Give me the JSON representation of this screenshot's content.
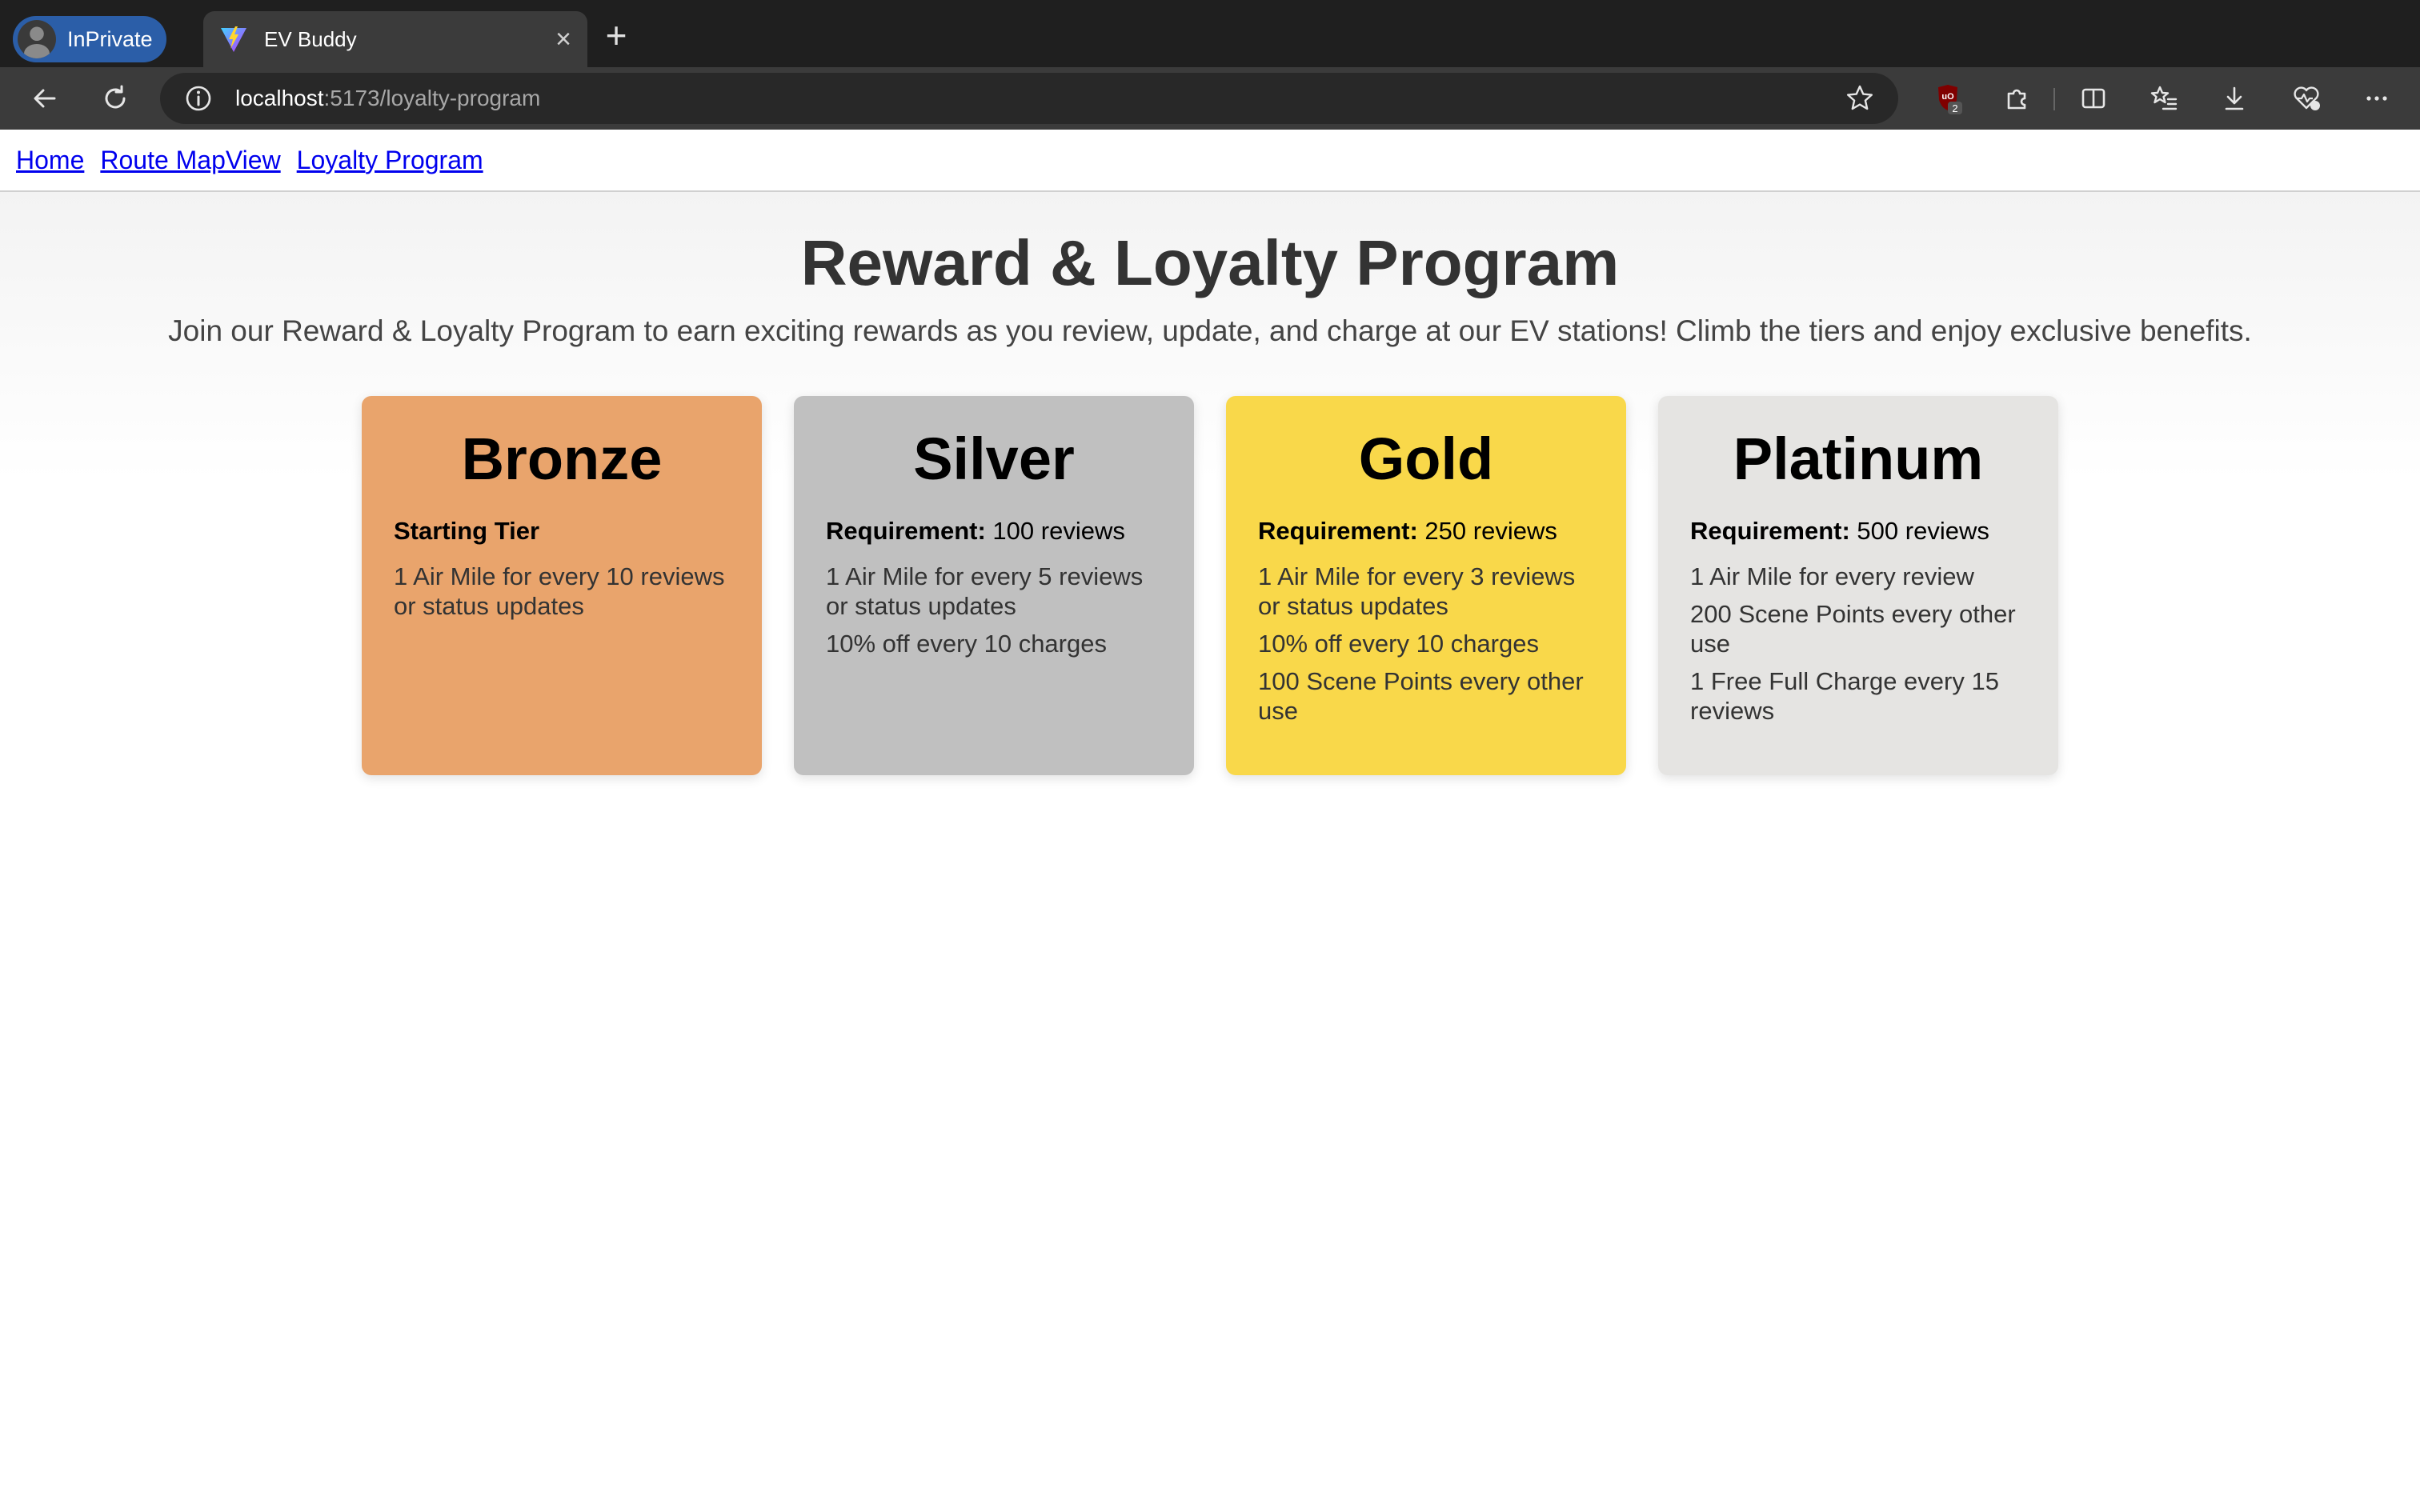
{
  "browser": {
    "inprivate_label": "InPrivate",
    "tab_title": "EV Buddy",
    "close_glyph": "×",
    "newtab_glyph": "+",
    "url_host": "localhost",
    "url_path": ":5173/loyalty-program",
    "extension_badge": "2"
  },
  "nav": {
    "links": [
      "Home",
      "Route MapView",
      "Loyalty Program"
    ]
  },
  "header": {
    "title": "Reward & Loyalty Program",
    "intro": "Join our Reward & Loyalty Program to earn exciting rewards as you review, update, and charge at our EV stations! Climb the tiers and enjoy exclusive benefits."
  },
  "tiers": [
    {
      "name": "Bronze",
      "requirement_label": "Starting Tier",
      "requirement_value": "",
      "benefits": [
        "1 Air Mile for every 10 reviews or status updates"
      ],
      "color": "#e9a46c"
    },
    {
      "name": "Silver",
      "requirement_label": "Requirement:",
      "requirement_value": " 100 reviews",
      "benefits": [
        "1 Air Mile for every 5 reviews or status updates",
        "10% off every 10 charges"
      ],
      "color": "#c0c0c0"
    },
    {
      "name": "Gold",
      "requirement_label": "Requirement:",
      "requirement_value": " 250 reviews",
      "benefits": [
        "1 Air Mile for every 3 reviews or status updates",
        "10% off every 10 charges",
        "100 Scene Points every other use"
      ],
      "color": "#f9d84a"
    },
    {
      "name": "Platinum",
      "requirement_label": "Requirement:",
      "requirement_value": " 500 reviews",
      "benefits": [
        "1 Air Mile for every review",
        "200 Scene Points every other use",
        "1 Free Full Charge every 15 reviews"
      ],
      "color": "#e5e4e2"
    }
  ],
  "icons": {
    "back": "arrow-left-icon",
    "refresh": "refresh-icon",
    "info": "info-icon",
    "favorite": "star-icon",
    "extensions": "puzzle-icon",
    "split": "split-screen-icon",
    "favorites": "favorites-icon",
    "downloads": "download-icon",
    "copilot": "heart-pulse-icon",
    "menu": "more-icon"
  }
}
